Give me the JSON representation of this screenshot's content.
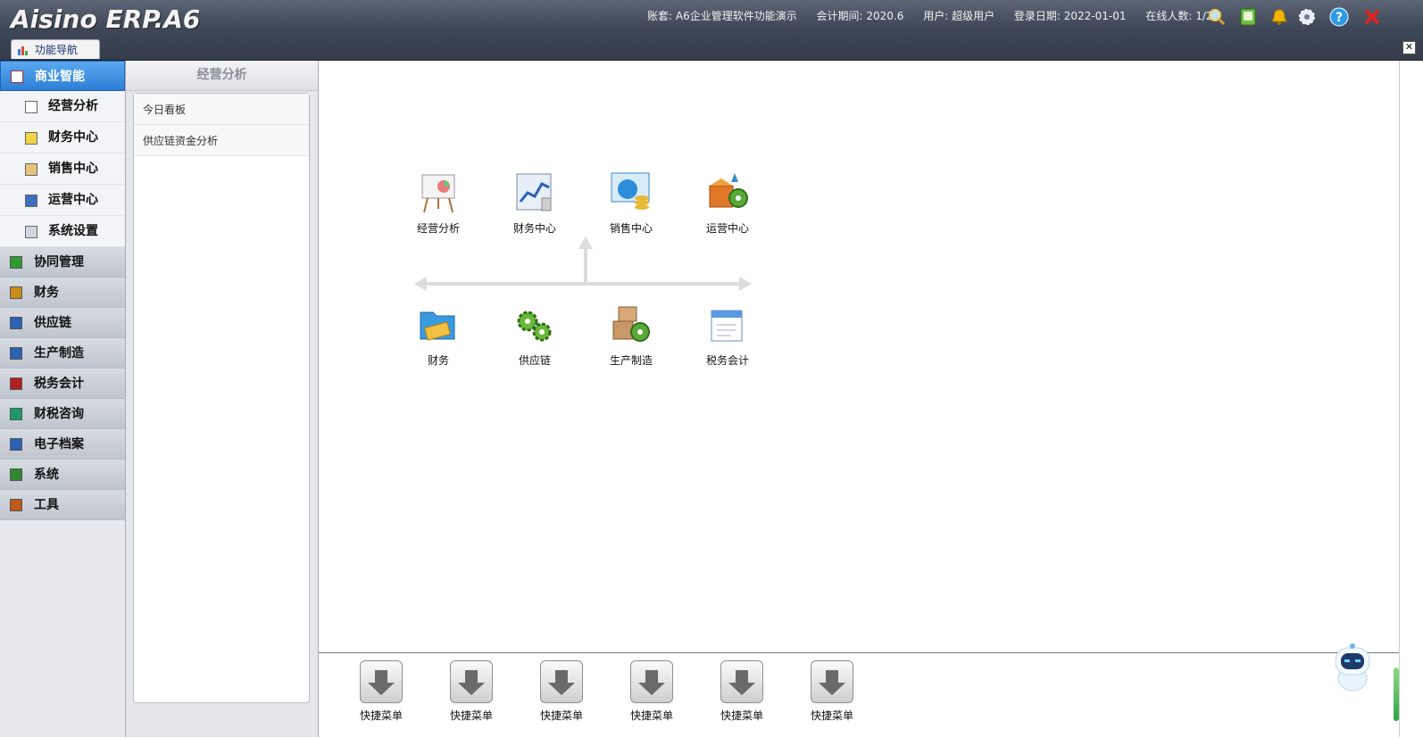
{
  "app": {
    "logo": "Aisino ERP.A6"
  },
  "header": {
    "account": "账套: A6企业管理软件功能演示",
    "period": "会计期间: 2020.6",
    "user": "用户: 超级用户",
    "login_date": "登录日期: 2022-01-01",
    "online": "在线人数: 1/2"
  },
  "tabs": {
    "nav_label": "功能导航"
  },
  "sidebar": {
    "items": [
      {
        "label": "商业智能",
        "color": "#d23c3c"
      },
      {
        "label": "协同管理",
        "color": "#2f9a2f"
      },
      {
        "label": "财务",
        "color": "#c98c1a"
      },
      {
        "label": "供应链",
        "color": "#2a62b5"
      },
      {
        "label": "生产制造",
        "color": "#2a62b5"
      },
      {
        "label": "税务会计",
        "color": "#b32020"
      },
      {
        "label": "财税咨询",
        "color": "#1e9a6a"
      },
      {
        "label": "电子档案",
        "color": "#2a62b5"
      },
      {
        "label": "系统",
        "color": "#2f8a2f"
      },
      {
        "label": "工具",
        "color": "#c05a1a"
      }
    ],
    "sub_items": [
      {
        "label": "经营分析"
      },
      {
        "label": "财务中心"
      },
      {
        "label": "销售中心"
      },
      {
        "label": "运营中心"
      },
      {
        "label": "系统设置"
      }
    ]
  },
  "panel2": {
    "title": "经营分析",
    "items": [
      "今日看板",
      "供应链资金分析"
    ]
  },
  "main": {
    "top_tiles": [
      "经营分析",
      "财务中心",
      "销售中心",
      "运营中心"
    ],
    "bottom_tiles": [
      "财务",
      "供应链",
      "生产制造",
      "税务会计"
    ]
  },
  "quickbar": {
    "buttons": [
      "快捷菜单",
      "快捷菜单",
      "快捷菜单",
      "快捷菜单",
      "快捷菜单",
      "快捷菜单"
    ]
  }
}
